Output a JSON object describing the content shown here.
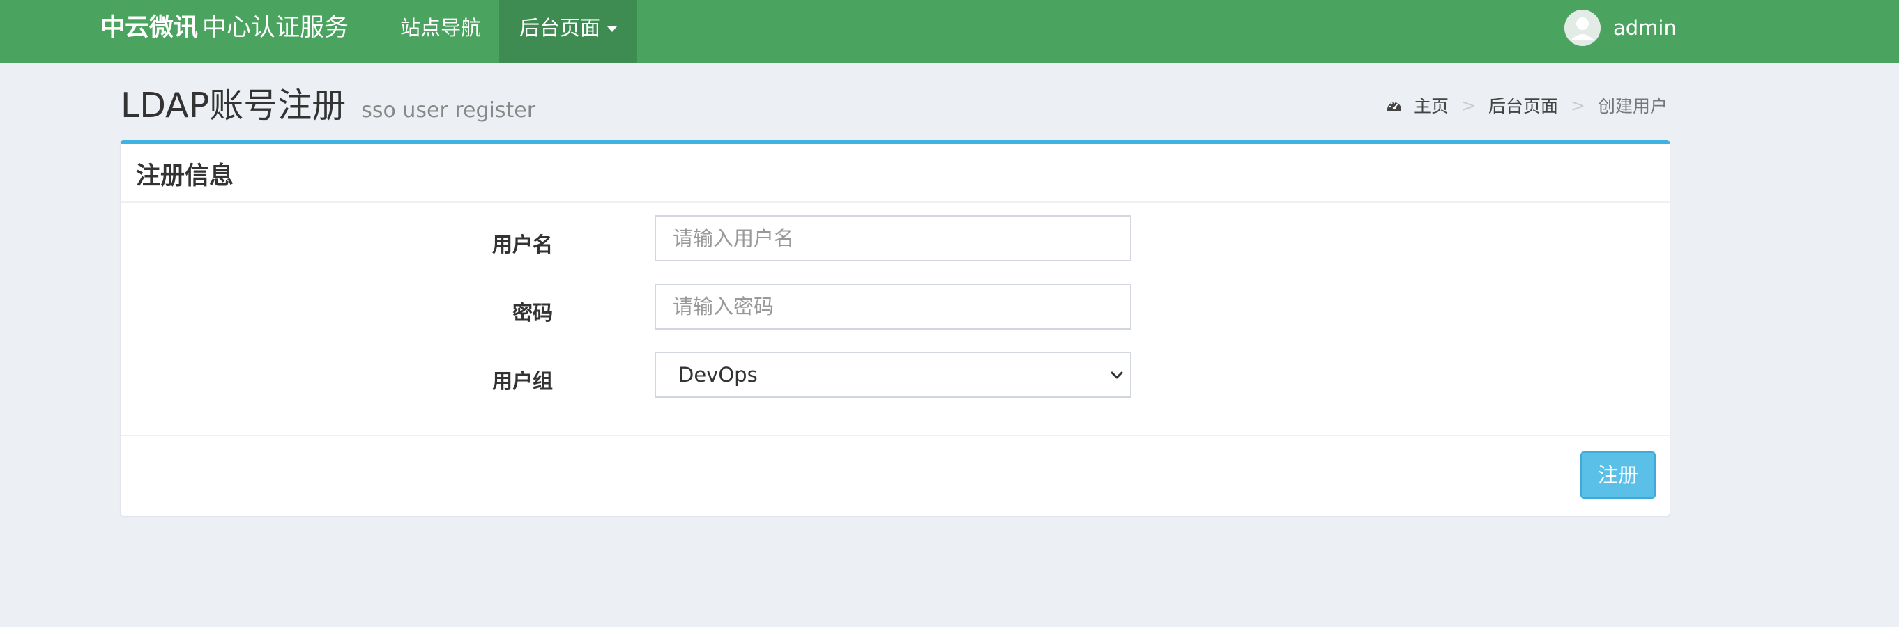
{
  "header": {
    "brand_bold": "中云微讯",
    "brand_sub": "中心认证服务",
    "nav": {
      "sites": "站点导航",
      "admin": "后台页面"
    },
    "user": {
      "name": "admin"
    }
  },
  "page": {
    "title": "LDAP账号注册",
    "subtitle": "sso user register"
  },
  "breadcrumb": {
    "items": [
      "主页",
      "后台页面",
      "创建用户"
    ],
    "separator": ">"
  },
  "form": {
    "title": "注册信息",
    "username": {
      "label": "用户名",
      "placeholder": "请输入用户名",
      "value": ""
    },
    "password": {
      "label": "密码",
      "placeholder": "请输入密码",
      "value": ""
    },
    "group": {
      "label": "用户组",
      "selected": "DevOps"
    },
    "submit_label": "注册"
  },
  "colors": {
    "header_bg": "#4aa35f",
    "header_active_bg": "#3e8c51",
    "page_bg": "#ecf0f5",
    "box_accent": "#3fb2e1",
    "button_bg": "#5bc0e8"
  },
  "icons": {
    "breadcrumb_home": "dashboard-icon",
    "user": "avatar-icon",
    "dropdown": "caret-down-icon",
    "select": "chevron-down-icon"
  }
}
